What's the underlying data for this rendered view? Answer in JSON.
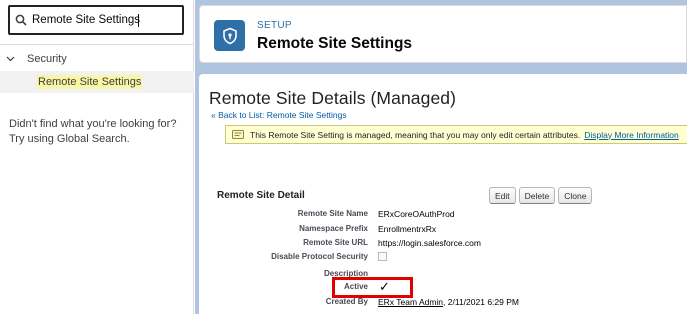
{
  "sidebar": {
    "quick_find_value": "Remote Site Settings",
    "section": {
      "label": "Security"
    },
    "selected_item": {
      "label": "Remote Site Settings"
    },
    "not_found_line1": "Didn't find what you're looking for?",
    "not_found_line2": "Try using Global Search."
  },
  "header": {
    "eyebrow": "SETUP",
    "title": "Remote Site Settings"
  },
  "detail": {
    "page_title": "Remote Site Details (Managed)",
    "back_link": "« Back to List: Remote Site Settings",
    "info_message": "This Remote Site Setting is managed, meaning that you may only edit certain attributes.",
    "info_link": "Display More Information",
    "section_title": "Remote Site Detail",
    "buttons": {
      "edit": "Edit",
      "delete": "Delete",
      "clone": "Clone"
    },
    "fields": [
      {
        "label": "Remote Site Name",
        "value": "ERxCoreOAuthProd"
      },
      {
        "label": "Namespace Prefix",
        "value": "EnrollmentrxRx"
      },
      {
        "label": "Remote Site URL",
        "value": "https://login.salesforce.com"
      },
      {
        "label": "Disable Protocol Security",
        "value": ""
      },
      {
        "label": "Description",
        "value": ""
      },
      {
        "label": "Active",
        "value": "✓"
      },
      {
        "label": "Created By",
        "value": "ERx Team Admin",
        "date": ", 2/11/2021 6:29 PM"
      }
    ]
  },
  "colors": {
    "brand_blue": "#2f6fa7",
    "highlight_box": "#e10000",
    "info_bar_bg": "#ffffd1"
  },
  "icons": [
    "search-icon",
    "chevron-down-icon",
    "setup-shield-icon",
    "info-icon",
    "checkmark-icon"
  ]
}
